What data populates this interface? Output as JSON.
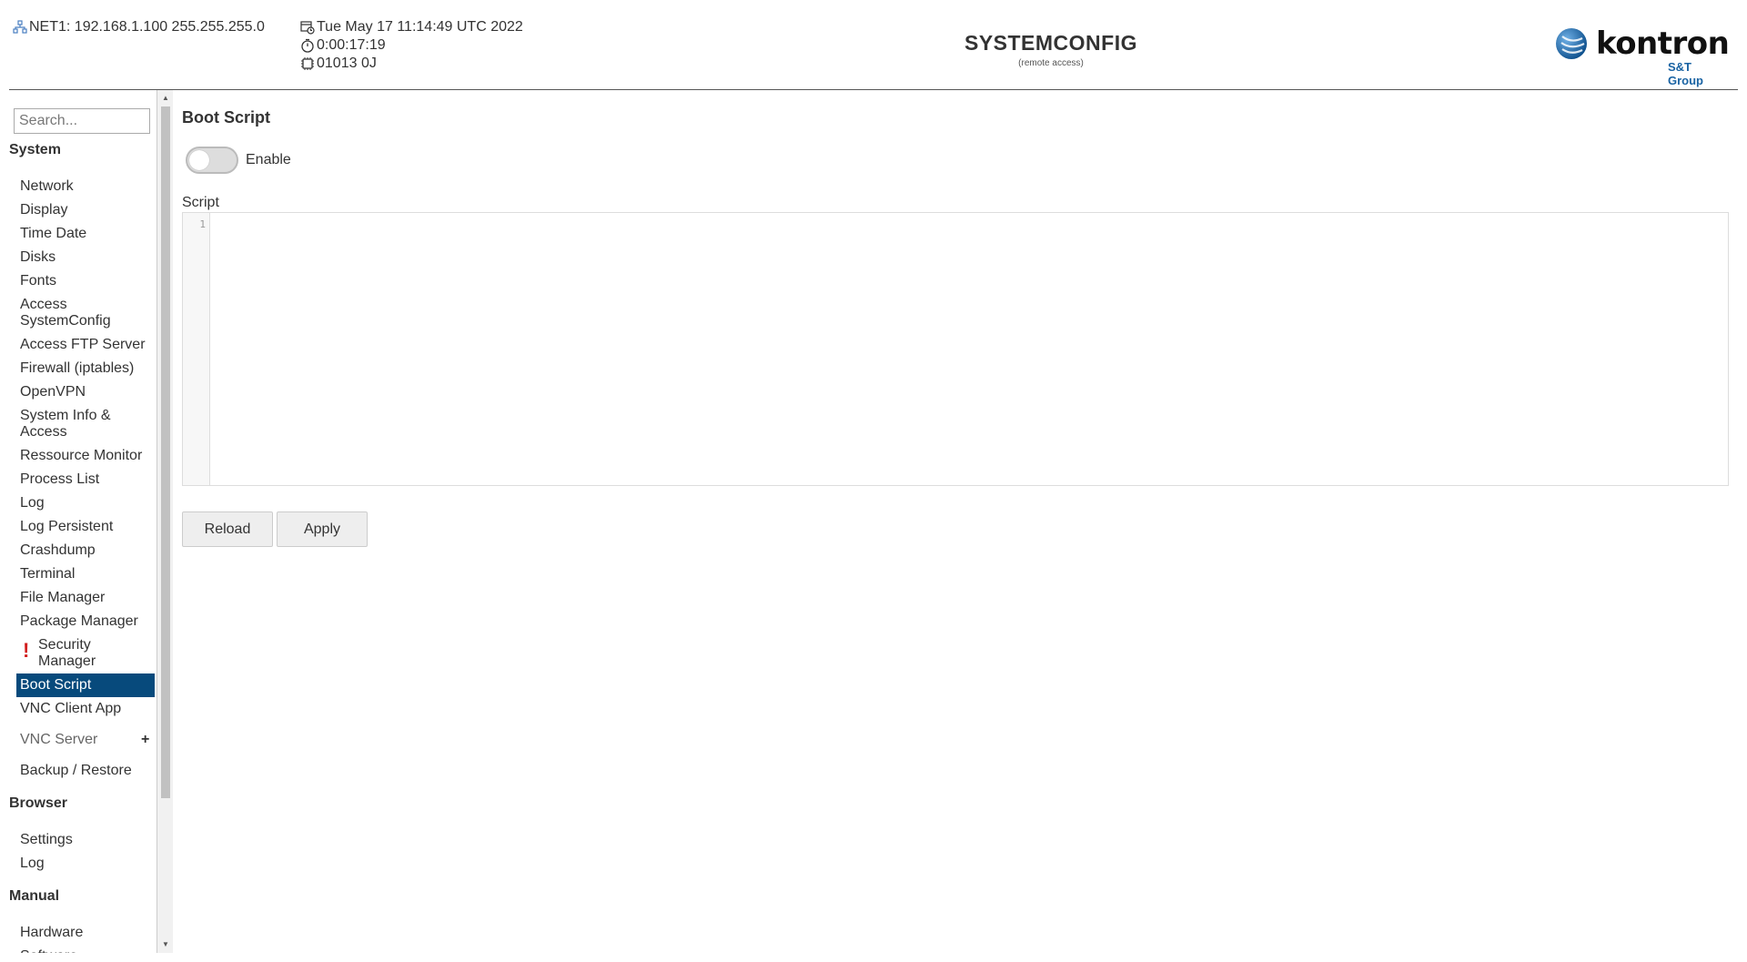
{
  "header": {
    "net_info": "NET1: 192.168.1.100 255.255.255.0",
    "datetime": "Tue May 17 11:14:49 UTC 2022",
    "uptime": "0:00:17:19",
    "device_id": "01013 0J",
    "title": "SYSTEMCONFIG",
    "subtitle": "(remote access)",
    "logo_word": "kontron",
    "logo_sub": "S&T Group",
    "icons": [
      "network-icon",
      "calendar-clock-icon",
      "stopwatch-icon",
      "chip-icon"
    ],
    "brand_color": "#1a63a3"
  },
  "sidebar": {
    "search_placeholder": "Search...",
    "sections": {
      "system": "System",
      "browser": "Browser",
      "manual": "Manual"
    },
    "system_items": [
      "Network",
      "Display",
      "Time Date",
      "Disks",
      "Fonts",
      "Access SystemConfig",
      "Access FTP Server",
      "Firewall (iptables)",
      "OpenVPN",
      "System Info & Access",
      "Ressource Monitor",
      "Process List",
      "Log",
      "Log Persistent",
      "Crashdump",
      "Terminal",
      "File Manager",
      "Package Manager",
      "Security Manager",
      "Boot Script",
      "VNC Client App",
      "VNC Server",
      "Backup / Restore"
    ],
    "warning_mark": "!",
    "expand_mark": "+",
    "browser_items": [
      "Settings",
      "Log"
    ],
    "manual_items": [
      "Hardware",
      "Software"
    ],
    "active_item": "Boot Script",
    "active_color": "#074a7c"
  },
  "main": {
    "page_title": "Boot Script",
    "enable_label": "Enable",
    "enable_on": false,
    "script_label": "Script",
    "line_number": "1",
    "script_content": "",
    "reload_label": "Reload",
    "apply_label": "Apply"
  }
}
